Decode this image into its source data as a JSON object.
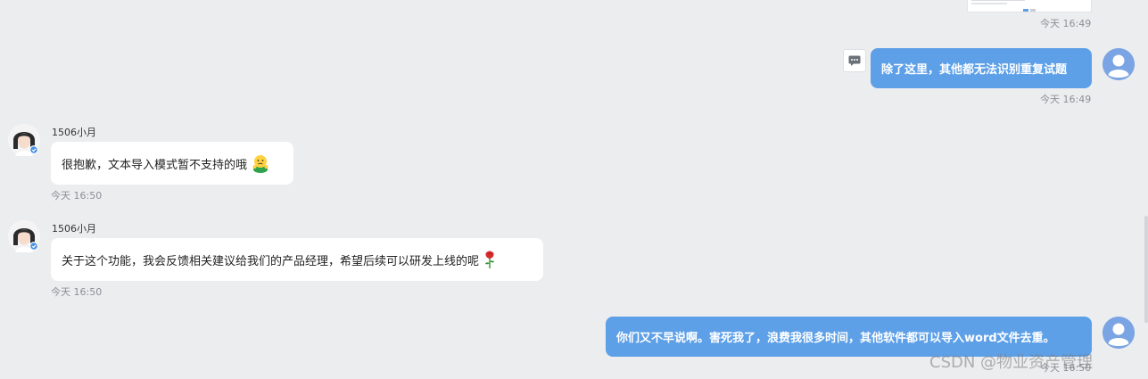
{
  "messages": [
    {
      "id": "m1",
      "direction": "outgoing",
      "type": "image",
      "time": "今天 16:49"
    },
    {
      "id": "m2",
      "direction": "outgoing",
      "type": "text",
      "text": "除了这里，其他都无法识别重复试题",
      "time": "今天 16:49"
    },
    {
      "id": "m3",
      "direction": "incoming",
      "sender": "1506小月",
      "type": "text",
      "text": "很抱歉，文本导入模式暂不支持的哦",
      "emoji": "sorry-emoji-icon",
      "time": "今天 16:50"
    },
    {
      "id": "m4",
      "direction": "incoming",
      "sender": "1506小月",
      "type": "text",
      "text": "关于这个功能，我会反馈相关建议给我们的产品经理，希望后续可以研发上线的呢",
      "emoji": "rose-emoji-icon",
      "time": "今天 16:50"
    },
    {
      "id": "m5",
      "direction": "outgoing",
      "type": "text",
      "text": "你们又不早说啊。害死我了，浪费我很多时间，其他软件都可以导入word文件去重。",
      "time": "今天 16:50"
    }
  ],
  "watermark": "CSDN @物业资产管理",
  "colors": {
    "background": "#ecedef",
    "outgoing_bubble": "#5da0e8",
    "incoming_bubble": "#ffffff",
    "user_avatar": "#7aa4e3"
  }
}
